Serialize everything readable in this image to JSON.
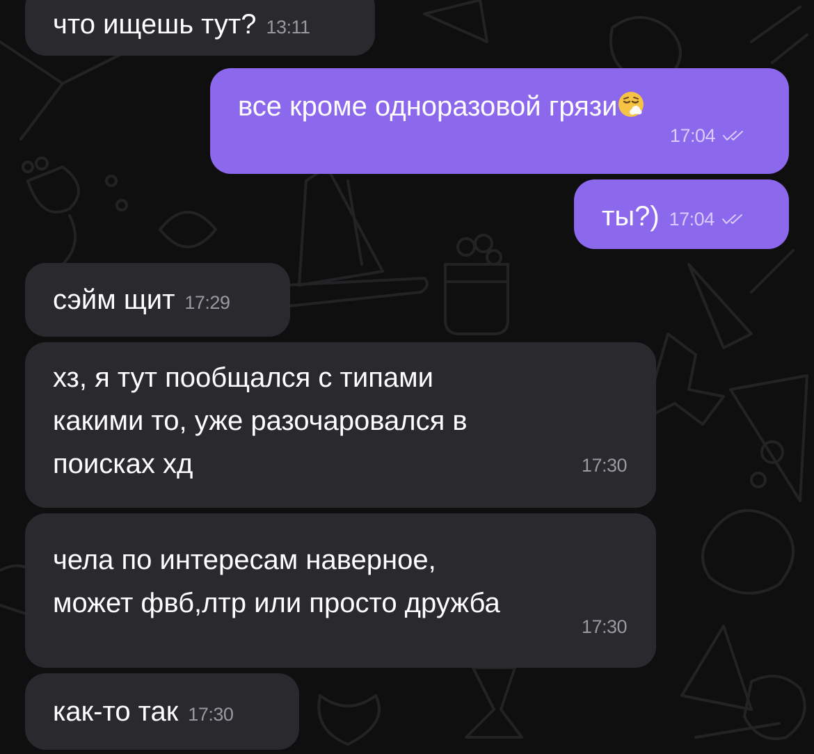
{
  "messages": [
    {
      "id": "m1",
      "direction": "incoming",
      "text": "что ищешь тут?",
      "time": "13:11"
    },
    {
      "id": "m2",
      "direction": "outgoing",
      "text": "все кроме одноразовой грязи",
      "emoji": "face-with-sweat-icon",
      "time": "17:04",
      "status": "read"
    },
    {
      "id": "m3",
      "direction": "outgoing",
      "text": "ты?)",
      "time": "17:04",
      "status": "read"
    },
    {
      "id": "m4",
      "direction": "incoming",
      "text": "сэйм щит",
      "time": "17:29"
    },
    {
      "id": "m5",
      "direction": "incoming",
      "text": "хз, я тут пообщался с типами\nкакими то, уже разочаровался в\nпоисках хд",
      "time": "17:30"
    },
    {
      "id": "m6",
      "direction": "incoming",
      "text": "чела по интересам наверное,\nможет фвб,лтр или просто дружба",
      "time": "17:30"
    },
    {
      "id": "m7",
      "direction": "incoming",
      "text": "как-то так",
      "time": "17:30"
    }
  ],
  "colors": {
    "background": "#0f0f10",
    "incoming_bubble": "#2a292e",
    "outgoing_bubble": "#8c68ec",
    "wallpaper_lines": "#232326"
  }
}
